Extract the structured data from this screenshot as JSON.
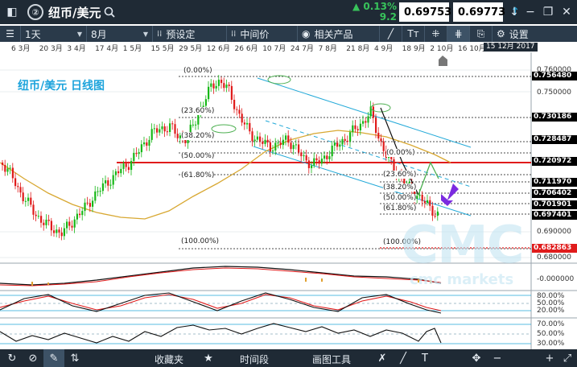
{
  "header": {
    "tab_number": "②",
    "title": "纽币/美元",
    "change_pct": "▲ 0.13%",
    "change_points": "9.2",
    "sell_price": "0.69753",
    "buy_price": "0.69773"
  },
  "toolbar": {
    "timeframe": "1天",
    "range": "8月",
    "preset": "预设定",
    "price_type": "中间价",
    "related": "相关产品",
    "text_size": "Tт",
    "settings": "设置"
  },
  "chart": {
    "title": "纽币/美元 日线图",
    "dates": [
      "6 3月",
      "20 3月",
      "3 4月",
      "17 4月",
      "1 5月",
      "15 5月",
      "29 5月",
      "12 6月",
      "26 6月",
      "10 7月",
      "24 7月",
      "7 8月",
      "21 8月",
      "4 9月",
      "18 9月",
      "2 10月",
      "16 10月"
    ],
    "date_highlight": "15 12月 2017",
    "axis_labels": [
      "0.760000",
      "0.750000",
      "0.690000",
      "0.680000"
    ],
    "price_tags": {
      "t1": "0.756480",
      "t2": "0.730186",
      "t3": "0.728487",
      "t4": "0.720972",
      "t5": "0.711970",
      "t6": "0.706402",
      "t7": "0.701901",
      "t8": "0.697401",
      "t9": "0.682863"
    },
    "fib_left": [
      "(0.00%)",
      "(23.60%)",
      "(38.20%)",
      "(50.00%)",
      "(61.80%)",
      "(100.00%)"
    ],
    "fib_right": [
      "(0.00%)",
      "(23.60%)",
      "(38.20%)",
      "(50.00%)",
      "(61.80%)",
      "(100.00%)"
    ],
    "watermark": "CMC",
    "watermark_sub": "cmc markets"
  },
  "indicators": {
    "macd": [
      "-0.000000"
    ],
    "stoch": [
      "80.00%",
      "50.00%",
      "20.00%"
    ],
    "rsi": [
      "70.00%",
      "50.00%",
      "30.00%"
    ]
  },
  "bottom": {
    "favorites": "收藏夹",
    "timeframe": "时间段",
    "drawing_tools": "画图工具"
  }
}
